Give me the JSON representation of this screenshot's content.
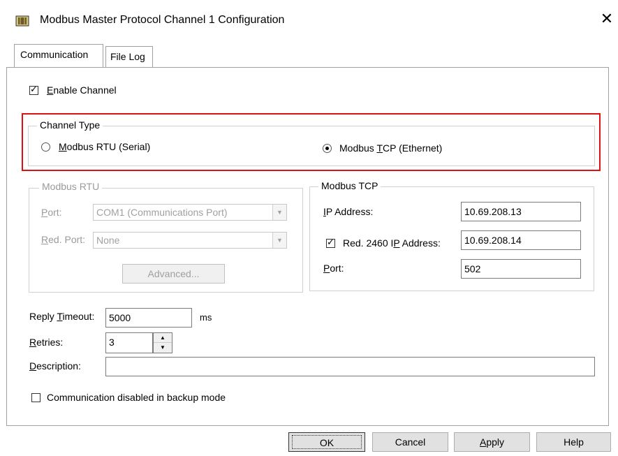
{
  "window": {
    "title": "Modbus Master Protocol Channel 1 Configuration",
    "close_glyph": "✕"
  },
  "tabs": [
    {
      "label": "Communication"
    },
    {
      "label": "File Log"
    }
  ],
  "enable_channel": {
    "label_pre": "E",
    "label_post": "nable Channel",
    "checked": true
  },
  "channel_type": {
    "legend": "Channel Type",
    "rtu": {
      "pre": "",
      "u": "M",
      "post": "odbus RTU (Serial)",
      "selected": false
    },
    "tcp": {
      "pre": "Modbus ",
      "u": "T",
      "post": "CP (Ethernet)",
      "selected": true
    }
  },
  "modbus_rtu": {
    "legend": "Modbus RTU",
    "port_label_u": "P",
    "port_label_post": "ort:",
    "port_value": "COM1 (Communications Port)",
    "red_port_label_u": "R",
    "red_port_label_post": "ed. Port:",
    "red_port_value": "None",
    "advanced_label": "Advanced..."
  },
  "modbus_tcp": {
    "legend": "Modbus TCP",
    "ip_label_u": "I",
    "ip_label_post": "P Address:",
    "ip_value": "10.69.208.13",
    "red_ip_label_pre": "Red. 2460 I",
    "red_ip_label_u": "P",
    "red_ip_label_post": " Address:",
    "red_ip_checked": true,
    "red_ip_value": "10.69.208.14",
    "port_label_u": "P",
    "port_label_post": "ort:",
    "port_value": "502"
  },
  "reply_timeout": {
    "label_pre": "Reply ",
    "label_u": "T",
    "label_post": "imeout:",
    "value": "5000",
    "unit": "ms"
  },
  "retries": {
    "label_u": "R",
    "label_post": "etries:",
    "value": "3"
  },
  "description": {
    "label_u": "D",
    "label_post": "escription:",
    "value": ""
  },
  "backup_mode": {
    "label": "Communication disabled in backup mode",
    "checked": false
  },
  "buttons": {
    "ok": "OK",
    "cancel": "Cancel",
    "apply_u": "A",
    "apply_post": "pply",
    "help": "Help"
  }
}
